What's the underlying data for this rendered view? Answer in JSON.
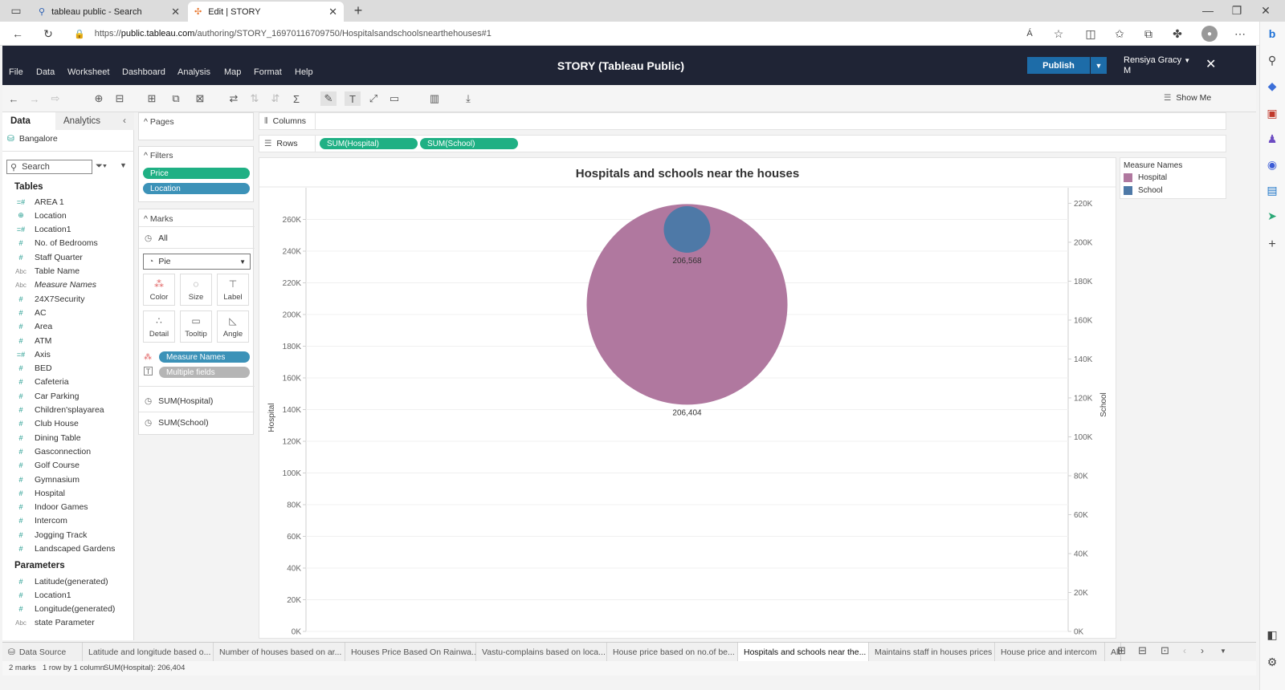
{
  "browser": {
    "tabs": [
      {
        "title": "tableau public - Search",
        "active": false
      },
      {
        "title": "Edit | STORY",
        "active": true
      }
    ],
    "url_prefix": "https://",
    "url_host": "public.tableau.com",
    "url_path": "/authoring/STORY_16970116709750/Hospitalsandschoolsnearthehouses#1",
    "read_aloud": "Á"
  },
  "app": {
    "title": "STORY (Tableau Public)",
    "menu": [
      "File",
      "Data",
      "Worksheet",
      "Dashboard",
      "Analysis",
      "Map",
      "Format",
      "Help"
    ],
    "publish_label": "Publish",
    "user_name_line1": "Rensiya Gracy",
    "user_name_line2": "M",
    "show_me_label": "Show Me"
  },
  "data_pane": {
    "tab_data": "Data",
    "tab_analytics": "Analytics",
    "datasource": "Bangalore",
    "search_placeholder": "Search",
    "tables_header": "Tables",
    "fields": [
      {
        "name": "AREA 1",
        "type": "measure-calc"
      },
      {
        "name": "Location",
        "type": "geo"
      },
      {
        "name": "Location1",
        "type": "measure-calc"
      },
      {
        "name": "No. of Bedrooms",
        "type": "measure"
      },
      {
        "name": "Staff Quarter",
        "type": "measure"
      },
      {
        "name": "Table Name",
        "type": "string"
      },
      {
        "name": "Measure Names",
        "type": "string-italic"
      },
      {
        "name": "24X7Security",
        "type": "measure"
      },
      {
        "name": "AC",
        "type": "measure"
      },
      {
        "name": "Area",
        "type": "measure"
      },
      {
        "name": "ATM",
        "type": "measure"
      },
      {
        "name": "Axis",
        "type": "measure-calc"
      },
      {
        "name": "BED",
        "type": "measure"
      },
      {
        "name": "Cafeteria",
        "type": "measure"
      },
      {
        "name": "Car Parking",
        "type": "measure"
      },
      {
        "name": "Children'splayarea",
        "type": "measure"
      },
      {
        "name": "Club House",
        "type": "measure"
      },
      {
        "name": "Dining Table",
        "type": "measure"
      },
      {
        "name": "Gasconnection",
        "type": "measure"
      },
      {
        "name": "Golf Course",
        "type": "measure"
      },
      {
        "name": "Gymnasium",
        "type": "measure"
      },
      {
        "name": "Hospital",
        "type": "measure"
      },
      {
        "name": "Indoor Games",
        "type": "measure"
      },
      {
        "name": "Intercom",
        "type": "measure"
      },
      {
        "name": "Jogging Track",
        "type": "measure"
      },
      {
        "name": "Landscaped Gardens",
        "type": "measure"
      }
    ],
    "parameters_header": "Parameters",
    "parameters": [
      {
        "name": "Latitude(generated)",
        "type": "measure"
      },
      {
        "name": "Location1",
        "type": "measure"
      },
      {
        "name": "Longitude(generated)",
        "type": "measure"
      },
      {
        "name": "state Parameter",
        "type": "string"
      }
    ]
  },
  "cards": {
    "pages_label": "Pages",
    "filters_label": "Filters",
    "filters": [
      "Price",
      "Location"
    ],
    "marks_label": "Marks",
    "marks_all": "All",
    "mark_type": "Pie",
    "mark_buttons": [
      "Color",
      "Size",
      "Label",
      "Detail",
      "Tooltip",
      "Angle"
    ],
    "mark_pills": [
      "Measure Names",
      "Multiple fields"
    ],
    "measure_sections": [
      "SUM(Hospital)",
      "SUM(School)"
    ]
  },
  "shelves": {
    "columns_label": "Columns",
    "rows_label": "Rows",
    "row_pills": [
      "SUM(Hospital)",
      "SUM(School)"
    ]
  },
  "legend": {
    "title": "Measure Names",
    "items": [
      {
        "label": "Hospital",
        "color": "#b0789f"
      },
      {
        "label": "School",
        "color": "#4e79a7"
      }
    ]
  },
  "chart_data": {
    "type": "pie",
    "title": "Hospitals and schools near the houses",
    "left_axis_label": "Hospital",
    "right_axis_label": "School",
    "left_ticks": [
      "0K",
      "20K",
      "40K",
      "60K",
      "80K",
      "100K",
      "120K",
      "140K",
      "160K",
      "180K",
      "200K",
      "220K",
      "240K",
      "260K"
    ],
    "right_ticks": [
      "0K",
      "20K",
      "40K",
      "60K",
      "80K",
      "100K",
      "120K",
      "140K",
      "160K",
      "180K",
      "200K",
      "220K"
    ],
    "left_ylim": [
      0,
      280000
    ],
    "right_ylim": [
      0,
      228000
    ],
    "series": [
      {
        "name": "Hospital",
        "value": 206404,
        "label": "206,404",
        "color": "#b0789f"
      },
      {
        "name": "School",
        "value": 206568,
        "label": "206,568",
        "color": "#4e79a7"
      }
    ]
  },
  "sheet_tabs": {
    "data_source": "Data Source",
    "tabs": [
      "Latitude and longitude based o...",
      "Number of houses based on ar...",
      "Houses Price Based On Rainwa...",
      "Vastu-complains based on loca...",
      "House price based on no.of be...",
      "Hospitals and schools near the...",
      "Maintains staff in houses prices",
      "House price and intercom",
      "All"
    ],
    "active_index": 5
  },
  "status": {
    "marks": "2 marks",
    "rows_cols": "1 row by 1 column",
    "sum": "SUM(Hospital): 206,404"
  }
}
